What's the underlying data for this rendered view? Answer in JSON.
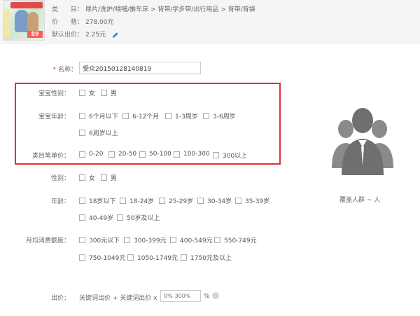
{
  "product": {
    "price_tag": "89",
    "category_label": "类　　目：",
    "category_value": "尿片/洗护/喂哺/推车床 > 背带/学步带/出行用品 > 背带/背袋",
    "price_label": "价　　格：",
    "price_value": "278.00元",
    "default_bid_label": "默认出价：",
    "default_bid_value": "2.25元"
  },
  "form": {
    "name_label": "名称：",
    "name_value": "受众20150128140819"
  },
  "baby_gender": {
    "label": "宝宝性别：",
    "options": [
      "女",
      "男"
    ]
  },
  "baby_age": {
    "label": "宝宝年龄：",
    "options": [
      "6个月以下",
      "6-12个月",
      "1-3周岁",
      "3-6周岁",
      "6周岁以上"
    ]
  },
  "category_price": {
    "label": "类目笔单价：",
    "options": [
      "0-20",
      "20-50",
      "50-100",
      "100-300",
      "300以上"
    ]
  },
  "gender": {
    "label": "性别：",
    "options": [
      "女",
      "男"
    ]
  },
  "age": {
    "label": "年龄：",
    "options": [
      "18岁以下",
      "18-24岁",
      "25-29岁",
      "30-34岁",
      "35-39岁",
      "40-49岁",
      "50岁及以上"
    ]
  },
  "monthly_spend": {
    "label": "月均消费额度：",
    "options": [
      "300元以下",
      "300-399元",
      "400-549元",
      "550-749元",
      "750-1049元",
      "1050-1749元",
      "1750元及以上"
    ]
  },
  "bid": {
    "label": "出价：",
    "formula": "关键词出价 + 关键词出价 x",
    "placeholder": "0%-300%",
    "unit": "%"
  },
  "coverage": {
    "text": "覆盖人群 ~ 人"
  },
  "colors": {
    "highlight_border": "#e03131",
    "required": "#e4393c",
    "avatar": "#707070"
  }
}
